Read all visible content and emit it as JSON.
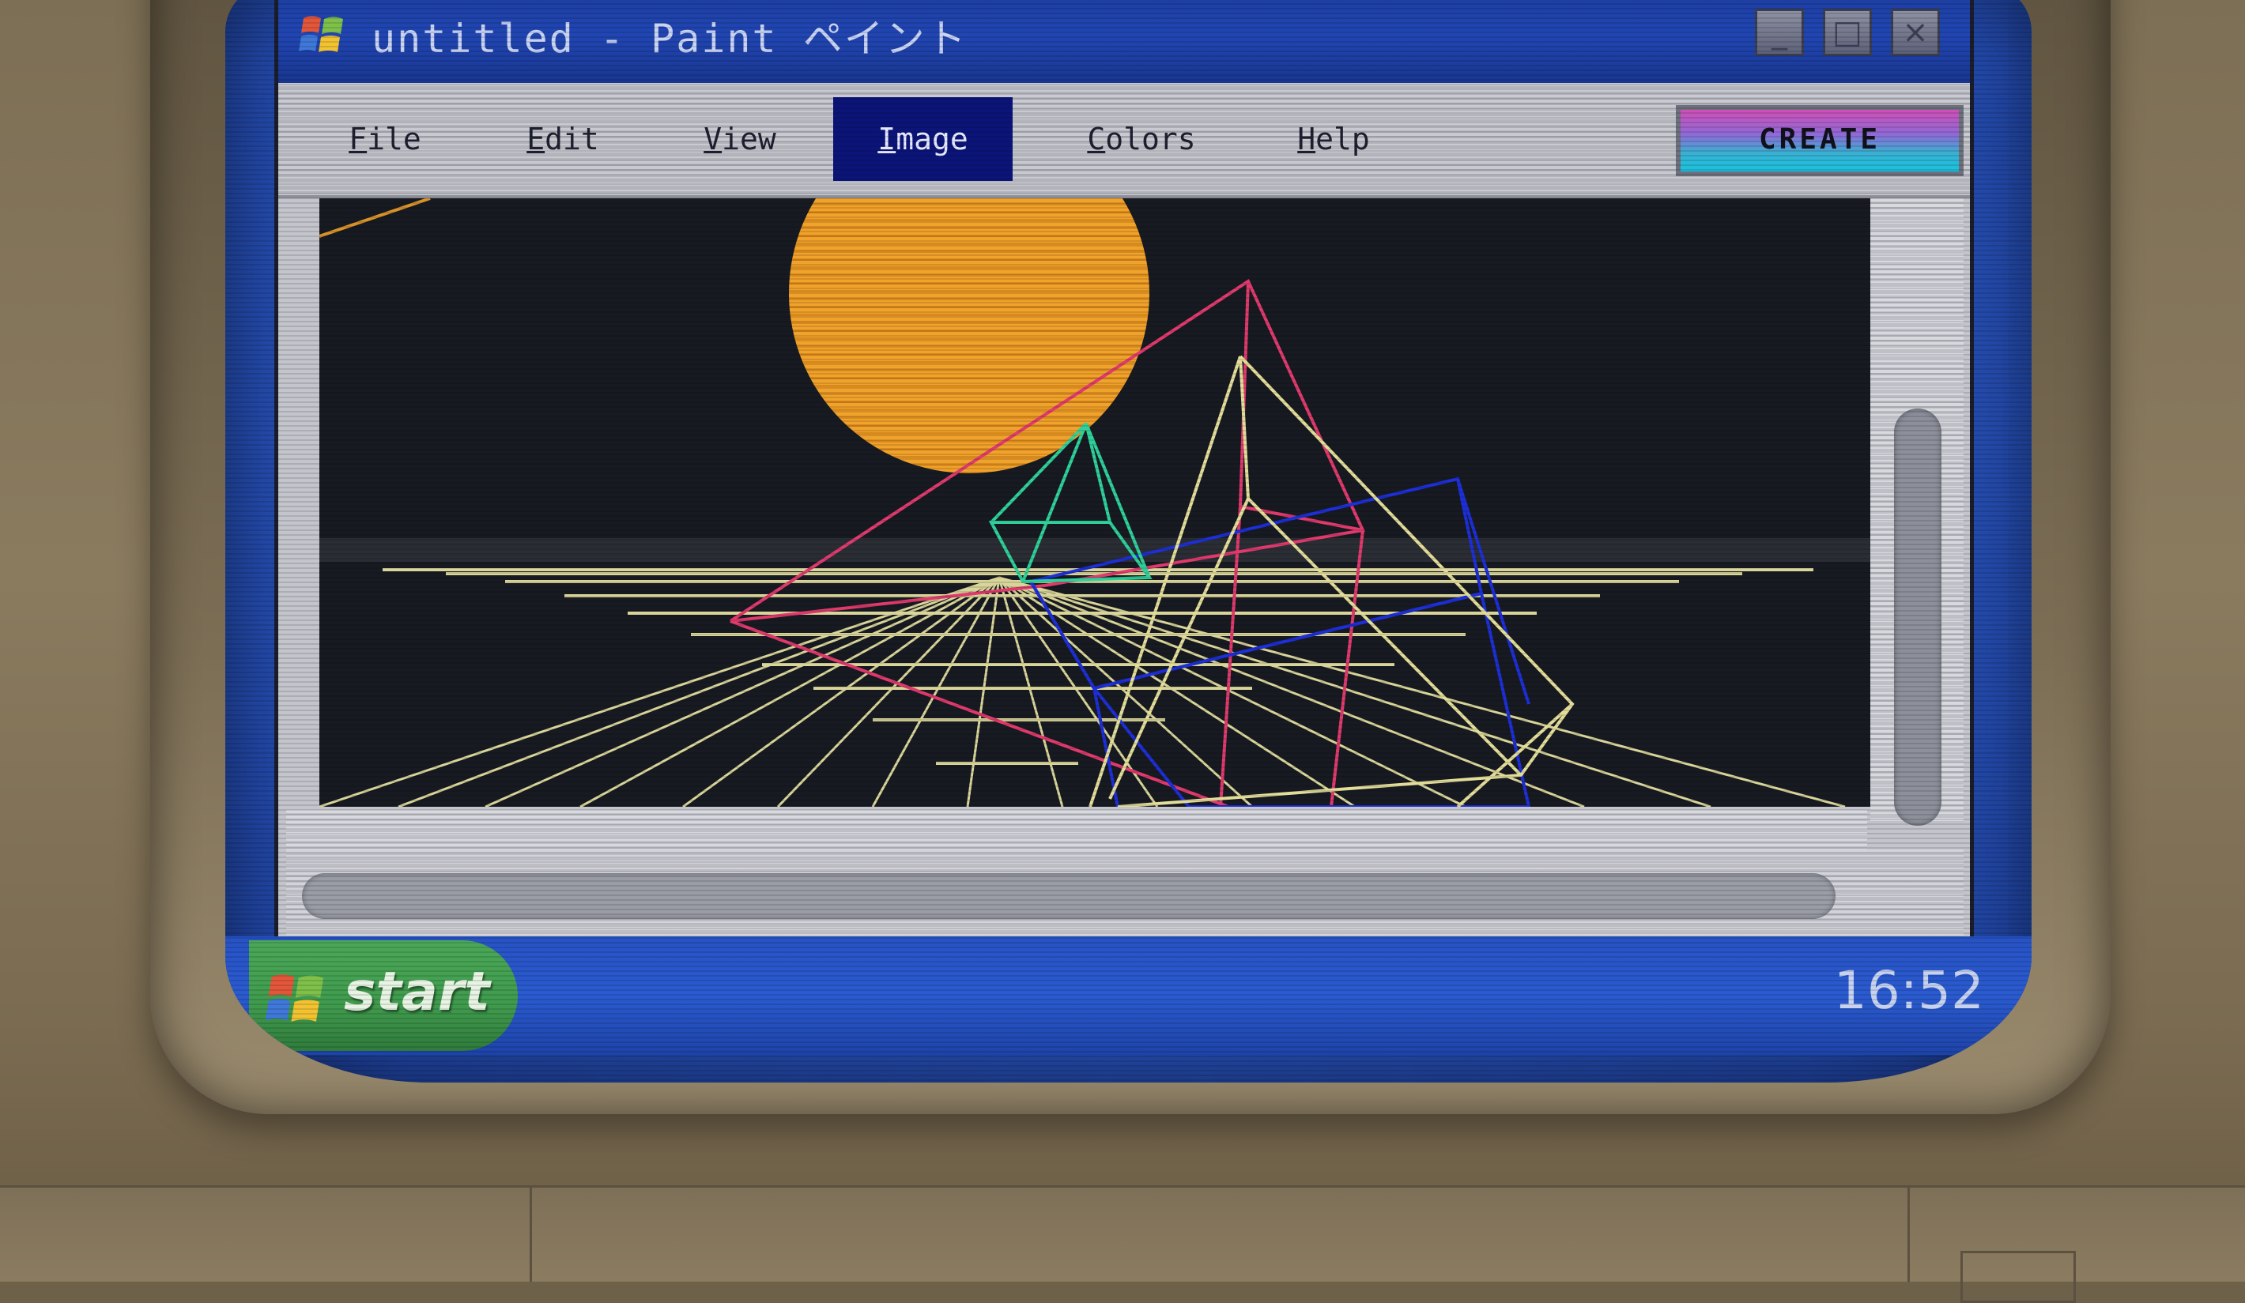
{
  "window": {
    "title": "untitled - Paint ペイント",
    "app_icon": "windows-flag-icon",
    "controls": {
      "minimize": "_",
      "maximize": "□",
      "close": "×"
    }
  },
  "menu": {
    "items": [
      {
        "label_first": "F",
        "label_rest": "ile"
      },
      {
        "label_first": "E",
        "label_rest": "dit"
      },
      {
        "label_first": "V",
        "label_rest": "iew"
      },
      {
        "label_first": "I",
        "label_rest": "mage",
        "active": true
      },
      {
        "label_first": "C",
        "label_rest": "olors"
      },
      {
        "label_first": "H",
        "label_rest": "elp"
      }
    ],
    "create_label": "CREATE"
  },
  "taskbar": {
    "start_label": "start",
    "start_icon": "windows-flag-icon",
    "clock": "16:52"
  },
  "colors": {
    "titlebar": "#2146b3",
    "menu_active": "#0b1478",
    "canvas_bg": "#171a21",
    "sun": "#f0a22a",
    "grid": "#d9d59a",
    "magenta": "#e03a6d",
    "green": "#2fd09a",
    "blue": "#1d2fd8",
    "yellow": "#e3dd9a",
    "start_green": "#3f9a4d"
  }
}
